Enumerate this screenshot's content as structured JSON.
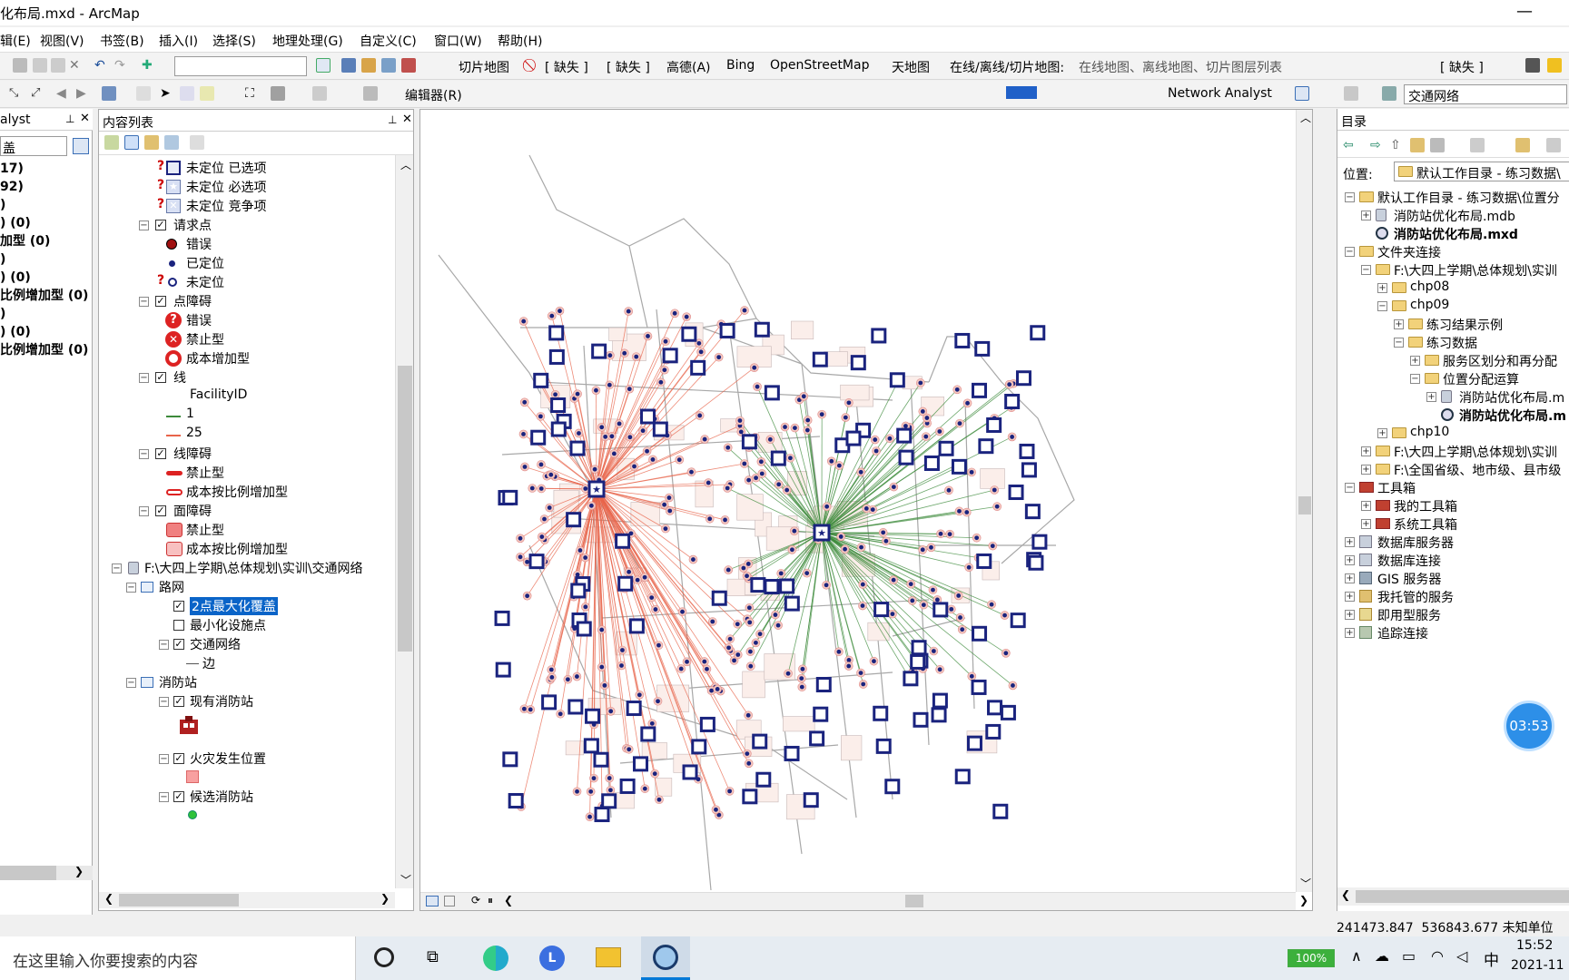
{
  "window": {
    "title": "化布局.mxd - ArcMap"
  },
  "menu": [
    "辑(E)",
    "视图(V)",
    "书签(B)",
    "插入(I)",
    "选择(S)",
    "地理处理(G)",
    "自定义(C)",
    "窗口(W)",
    "帮助(H)"
  ],
  "toolbar1": {
    "tile_map": "切片地图",
    "missing1": "[ 缺失 ]",
    "missing2": "[ 缺失 ]",
    "gaode": "高德(A)",
    "bing": "Bing",
    "osm": "OpenStreetMap",
    "tianditu": "天地图",
    "online_label": "在线/离线/切片地图:",
    "online_value": "在线地图、离线地图、切片图层列表",
    "missing3": "[ 缺失 ]"
  },
  "toolbar2": {
    "editor": "编辑器(R)",
    "network_analyst": "Network Analyst",
    "network_dataset": "交通网络"
  },
  "na_panel": {
    "title": "alyst",
    "combo": "盖",
    "items": [
      "17)",
      "92)",
      ")",
      ") (0)",
      "加型 (0)",
      ")",
      ") (0)",
      "比例增加型 (0)",
      ")",
      ") (0)",
      "比例增加型 (0)"
    ]
  },
  "toc": {
    "title": "内容列表",
    "rows": [
      {
        "text": "未定位 已选项"
      },
      {
        "text": "未定位 必选项"
      },
      {
        "text": "未定位 竞争项"
      },
      {
        "text": "请求点"
      },
      {
        "text": "错误"
      },
      {
        "text": "已定位"
      },
      {
        "text": "未定位"
      },
      {
        "text": "点障碍"
      },
      {
        "text": "错误"
      },
      {
        "text": "禁止型"
      },
      {
        "text": "成本增加型"
      },
      {
        "text": "线"
      },
      {
        "text": "FacilityID"
      },
      {
        "text": "1"
      },
      {
        "text": "25"
      },
      {
        "text": "线障碍"
      },
      {
        "text": "禁止型"
      },
      {
        "text": "成本按比例增加型"
      },
      {
        "text": "面障碍"
      },
      {
        "text": "禁止型"
      },
      {
        "text": "成本按比例增加型"
      },
      {
        "text": "F:\\大四上学期\\总体规划\\实训\\交通网络"
      },
      {
        "text": "路网"
      },
      {
        "text": "2点最大化覆盖"
      },
      {
        "text": "最小化设施点"
      },
      {
        "text": "交通网络"
      },
      {
        "text": "边"
      },
      {
        "text": "消防站"
      },
      {
        "text": "现有消防站"
      },
      {
        "text": "火灾发生位置"
      },
      {
        "text": "候选消防站"
      }
    ]
  },
  "catalog": {
    "title": "目录",
    "location_label": "位置:",
    "location_value": "默认工作目录 - 练习数据\\",
    "items": [
      "默认工作目录 - 练习数据\\位置分",
      "消防站优化布局.mdb",
      "消防站优化布局.mxd",
      "文件夹连接",
      "F:\\大四上学期\\总体规划\\实训",
      "chp08",
      "chp09",
      "练习结果示例",
      "练习数据",
      "服务区划分和再分配",
      "位置分配运算",
      "消防站优化布局.m",
      "消防站优化布局.m",
      "chp10",
      "F:\\大四上学期\\总体规划\\实训",
      "F:\\全国省级、地市级、县市级",
      "工具箱",
      "我的工具箱",
      "系统工具箱",
      "数据库服务器",
      "数据库连接",
      "GIS 服务器",
      "我托管的服务",
      "即用型服务",
      "追踪连接"
    ]
  },
  "timer": "03:53",
  "status": {
    "coords": "241473.847  536843.677 未知单位"
  },
  "taskbar": {
    "search": "在这里输入你要搜索的内容",
    "battery": "100%",
    "ime": "中",
    "time": "15:52",
    "date": "2021-11"
  },
  "colors": {
    "accent": "#0078d7",
    "red_lines": "#e8644a",
    "green_lines": "#3c8a3a",
    "points": "#1a237e"
  }
}
